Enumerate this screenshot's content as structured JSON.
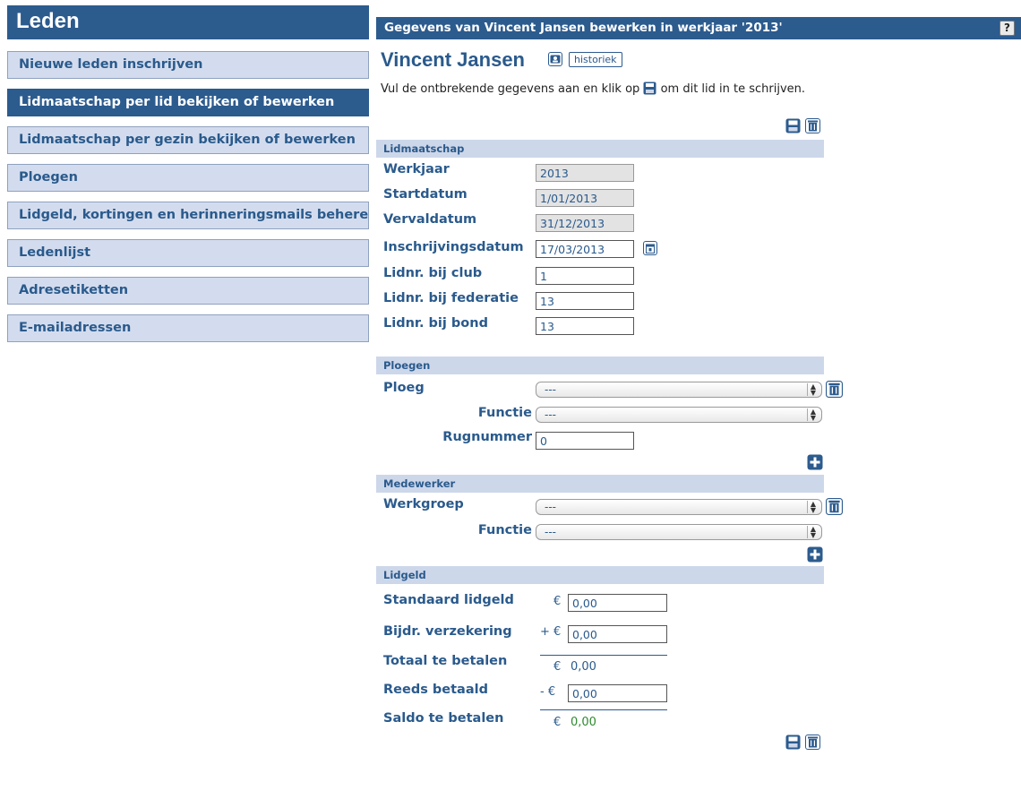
{
  "sidebar": {
    "title": "Leden",
    "items": [
      {
        "label": "Nieuwe leden inschrijven"
      },
      {
        "label": "Lidmaatschap per lid bekijken of bewerken"
      },
      {
        "label": "Lidmaatschap per gezin bekijken of bewerken"
      },
      {
        "label": "Ploegen"
      },
      {
        "label": "Lidgeld, kortingen en herinneringsmails beheren"
      },
      {
        "label": "Ledenlijst"
      },
      {
        "label": "Adresetiketten"
      },
      {
        "label": "E-mailadressen"
      }
    ],
    "active_index": 1
  },
  "header": {
    "title": "Gegevens van Vincent Jansen bewerken in werkjaar '2013'",
    "help_label": "?"
  },
  "person": {
    "name": "Vincent Jansen",
    "historiek_label": "historiek"
  },
  "intro": {
    "before_icon": "Vul de ontbrekende gegevens aan en klik op",
    "after_icon": "om dit lid in te schrijven."
  },
  "lidmaatschap": {
    "section_title": "Lidmaatschap",
    "werkjaar": {
      "label": "Werkjaar",
      "value": "2013"
    },
    "startdatum": {
      "label": "Startdatum",
      "value": "1/01/2013"
    },
    "vervaldatum": {
      "label": "Vervaldatum",
      "value": "31/12/2013"
    },
    "inschrijvingsdatum": {
      "label": "Inschrijvingsdatum",
      "value": "17/03/2013"
    },
    "lidnr_club": {
      "label": "Lidnr. bij club",
      "value": "1"
    },
    "lidnr_federatie": {
      "label": "Lidnr. bij federatie",
      "value": "13"
    },
    "lidnr_bond": {
      "label": "Lidnr. bij bond",
      "value": "13"
    }
  },
  "ploegen": {
    "section_title": "Ploegen",
    "ploeg": {
      "label": "Ploeg",
      "value": "---"
    },
    "functie": {
      "label": "Functie",
      "value": "---"
    },
    "rugnummer": {
      "label": "Rugnummer",
      "value": "0"
    }
  },
  "medewerker": {
    "section_title": "Medewerker",
    "werkgroep": {
      "label": "Werkgroep",
      "value": "---"
    },
    "functie": {
      "label": "Functie",
      "value": "---"
    }
  },
  "lidgeld": {
    "section_title": "Lidgeld",
    "standaard": {
      "label": "Standaard lidgeld",
      "prefix": "€",
      "value": "0,00"
    },
    "verzekering": {
      "label": "Bijdr. verzekering",
      "prefix": "+ €",
      "value": "0,00"
    },
    "totaal": {
      "label": "Totaal te betalen",
      "prefix": "€",
      "value": "0,00"
    },
    "betaald": {
      "label": "Reeds betaald",
      "prefix": "- €",
      "value": "0,00"
    },
    "saldo": {
      "label": "Saldo te betalen",
      "prefix": "€",
      "value": "0,00"
    }
  },
  "icons": {
    "save": "save-icon",
    "delete": "trash-icon",
    "add": "plus-icon",
    "calendar": "calendar-icon",
    "person_card": "person-card-icon"
  },
  "colors": {
    "brand": "#2c5b8e",
    "nav_bg": "#d3dcee",
    "section_bg": "#cdd7ea",
    "saldo": "#2e8a2e"
  }
}
